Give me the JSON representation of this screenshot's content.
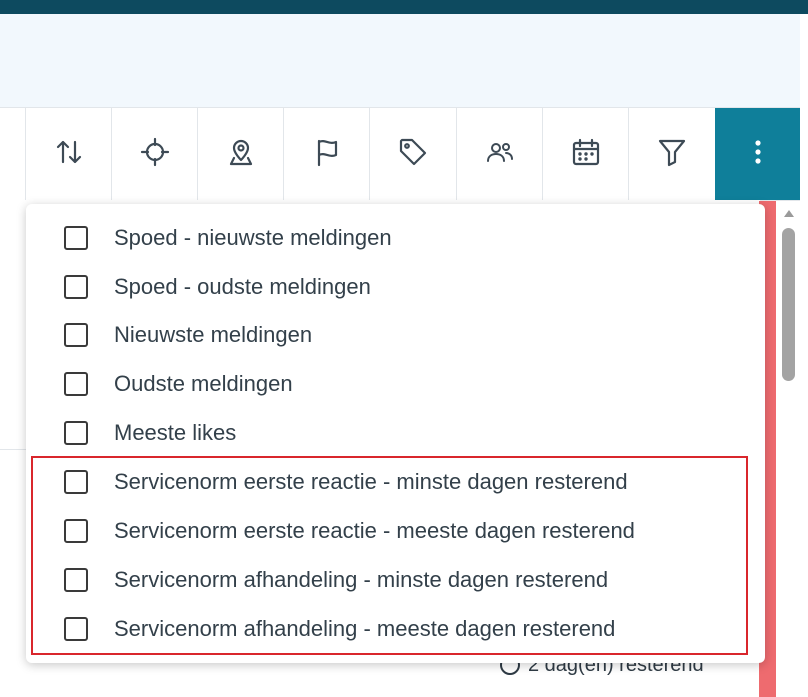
{
  "toolbar": {
    "buttons": [
      {
        "icon": "sort-arrows-icon"
      },
      {
        "icon": "crosshair-icon"
      },
      {
        "icon": "location-pin-icon"
      },
      {
        "icon": "flag-icon"
      },
      {
        "icon": "tag-icon"
      },
      {
        "icon": "users-icon"
      },
      {
        "icon": "calendar-icon"
      },
      {
        "icon": "filter-icon"
      },
      {
        "icon": "more-vertical-icon",
        "active": true
      }
    ]
  },
  "sort_menu": {
    "options": [
      {
        "label": "Spoed - nieuwste meldingen",
        "checked": false
      },
      {
        "label": "Spoed - oudste meldingen",
        "checked": false
      },
      {
        "label": "Nieuwste meldingen",
        "checked": false
      },
      {
        "label": "Oudste meldingen",
        "checked": false
      },
      {
        "label": "Meeste likes",
        "checked": false
      },
      {
        "label": "Servicenorm eerste reactie - minste dagen resterend",
        "checked": false
      },
      {
        "label": "Servicenorm eerste reactie - meeste dagen resterend",
        "checked": false
      },
      {
        "label": "Servicenorm afhandeling - minste dagen resterend",
        "checked": false
      },
      {
        "label": "Servicenorm afhandeling - meeste dagen resterend",
        "checked": false
      }
    ]
  },
  "background": {
    "remaining_text": "2 dag(en) resterend"
  },
  "colors": {
    "topbar": "#0d4a5f",
    "active_button": "#0f7f9a",
    "status_strip": "#ee6b6f",
    "highlight_border": "#d9262c"
  }
}
